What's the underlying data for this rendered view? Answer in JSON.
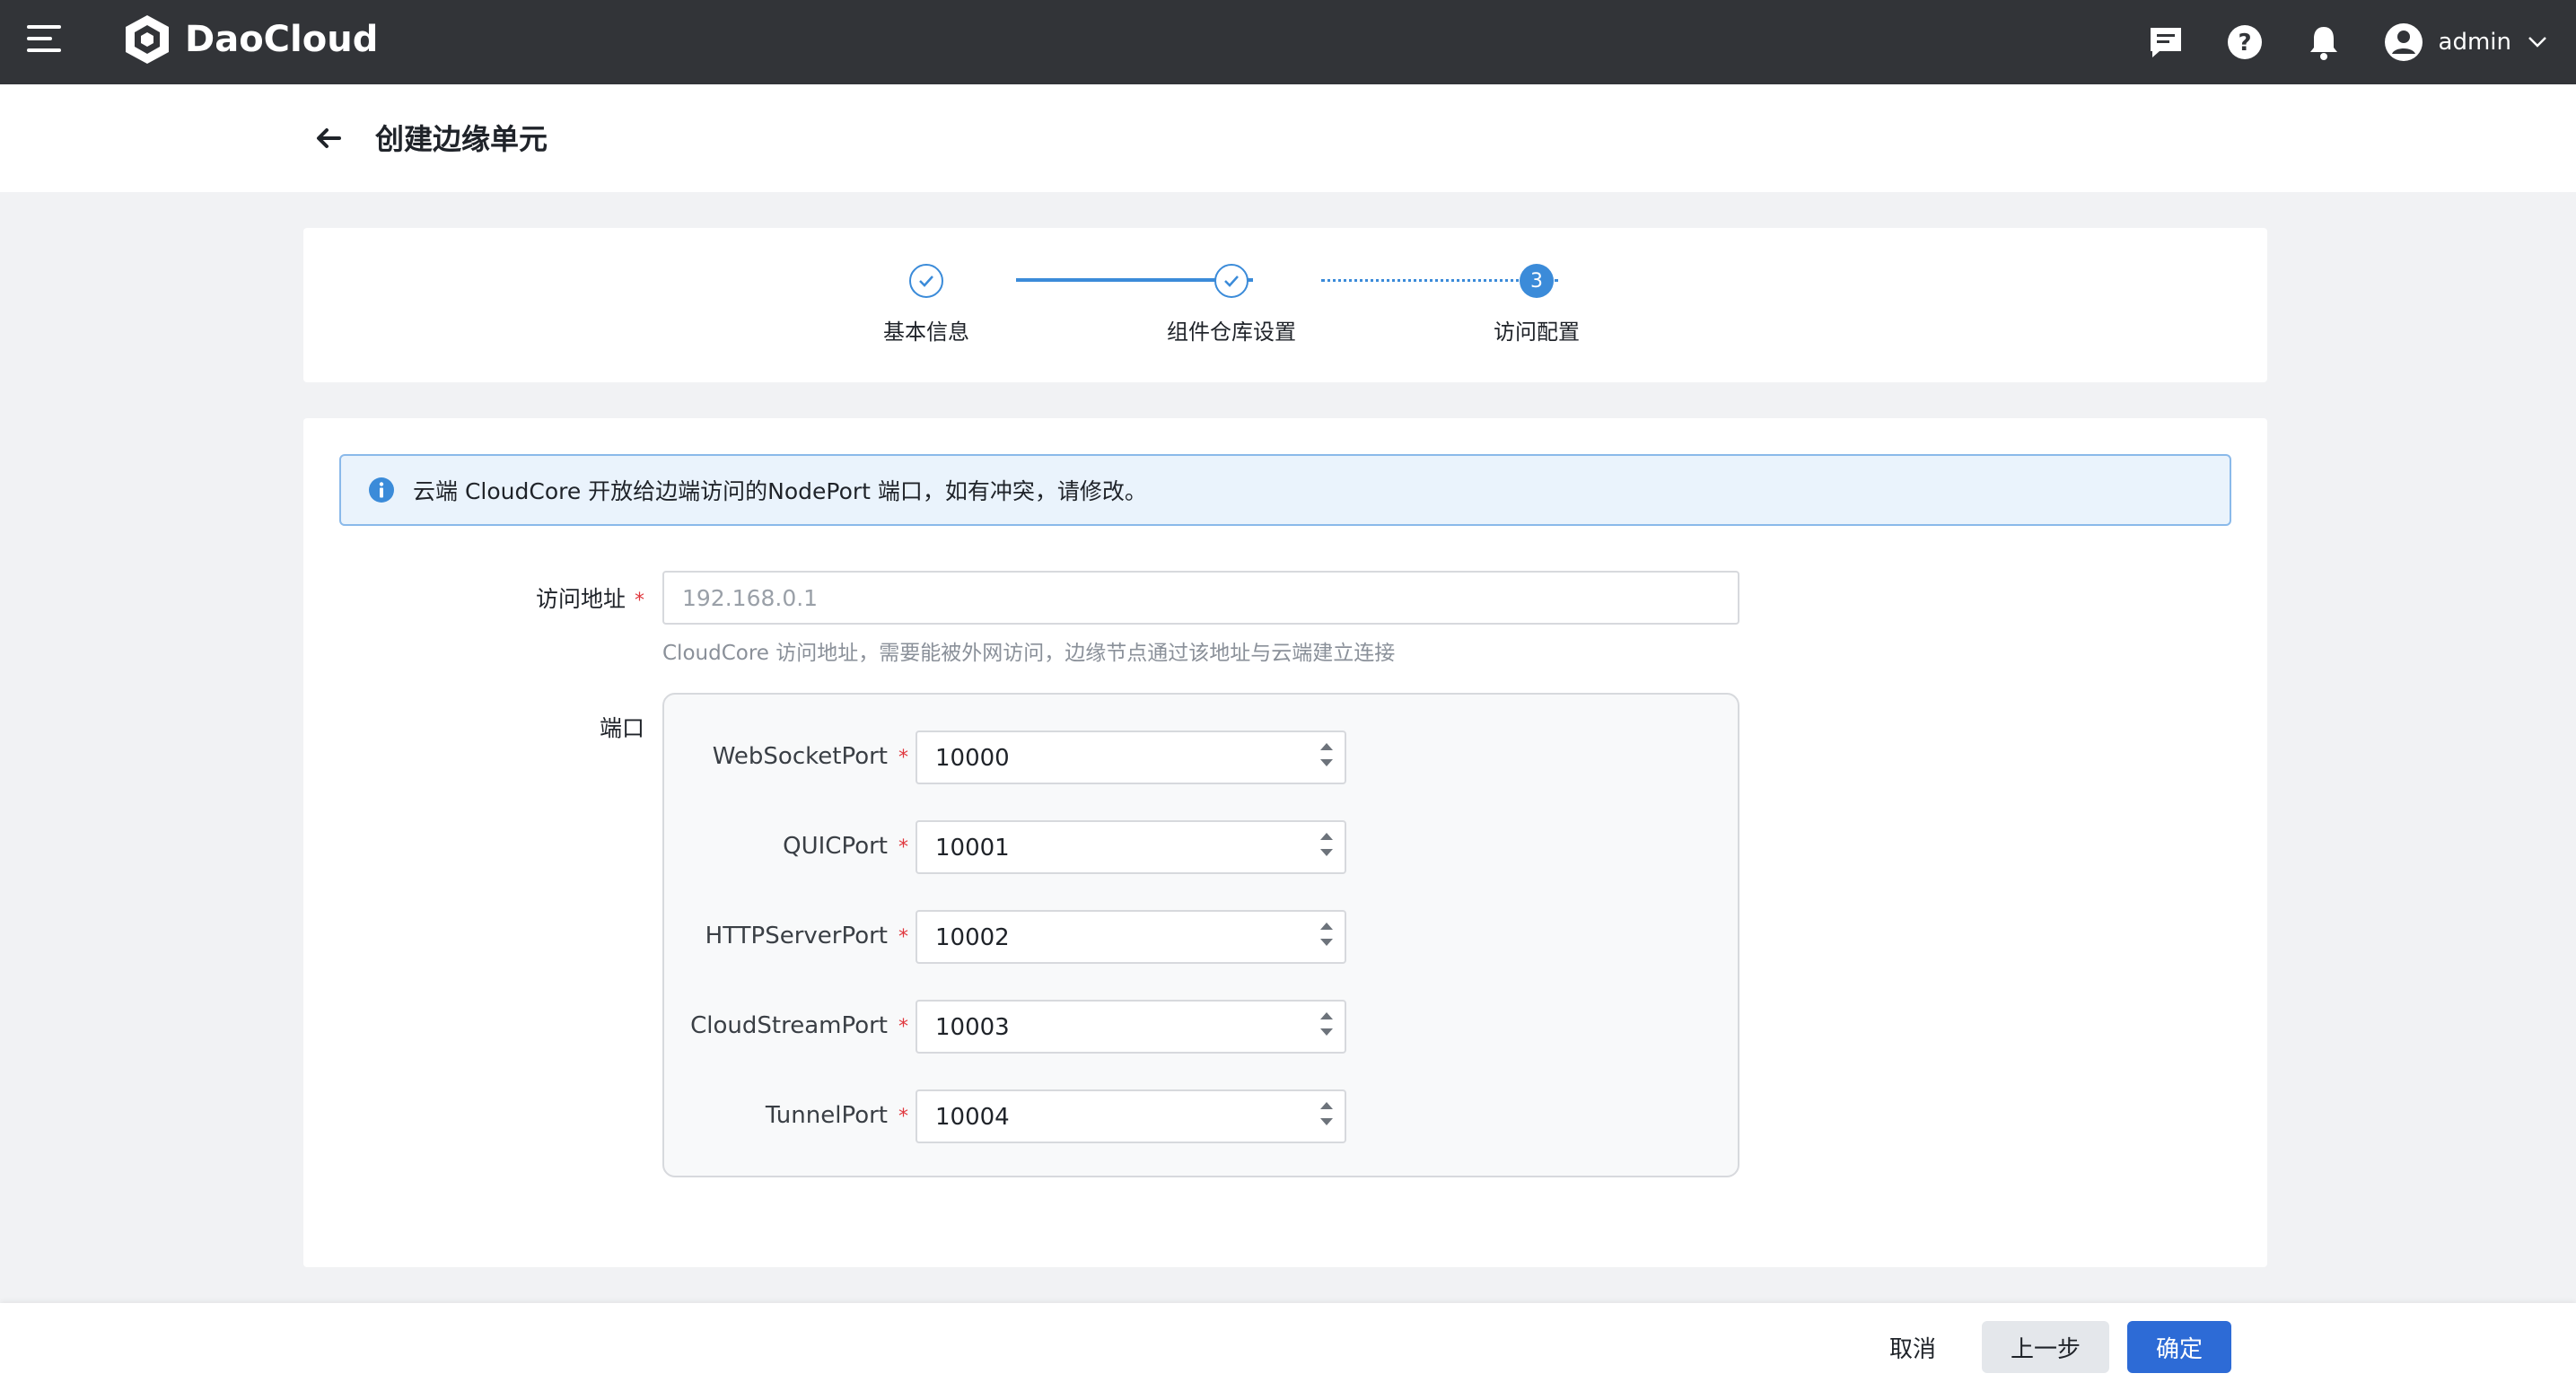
{
  "app": {
    "brand": "DaoCloud",
    "user": "admin"
  },
  "header": {
    "title": "创建边缘单元"
  },
  "steps": [
    {
      "label": "基本信息",
      "state": "done"
    },
    {
      "label": "组件仓库设置",
      "state": "done"
    },
    {
      "label": "访问配置",
      "state": "active",
      "number": "3"
    }
  ],
  "alert": {
    "text": "云端 CloudCore 开放给边端访问的NodePort 端口，如有冲突，请修改。"
  },
  "form": {
    "address": {
      "label": "访问地址",
      "required_mark": "*",
      "value": "",
      "placeholder": "192.168.0.1",
      "hint": "CloudCore 访问地址，需要能被外网访问，边缘节点通过该地址与云端建立连接"
    },
    "ports": {
      "label": "端口",
      "items": [
        {
          "name": "WebSocketPort",
          "value": "10000"
        },
        {
          "name": "QUICPort",
          "value": "10001"
        },
        {
          "name": "HTTPServerPort",
          "value": "10002"
        },
        {
          "name": "CloudStreamPort",
          "value": "10003"
        },
        {
          "name": "TunnelPort",
          "value": "10004"
        }
      ]
    }
  },
  "footer": {
    "cancel": "取消",
    "prev": "上一步",
    "ok": "确定"
  },
  "colors": {
    "topbar": "#323438",
    "accent": "#3b8bd9",
    "primary_button": "#2d6bd6",
    "required": "#e0383e"
  },
  "icons": [
    "menu-icon",
    "daocloud-logo-icon",
    "message-icon",
    "help-icon",
    "bell-icon",
    "user-avatar-icon",
    "chevron-down-icon",
    "back-arrow-icon",
    "check-icon",
    "info-icon"
  ]
}
